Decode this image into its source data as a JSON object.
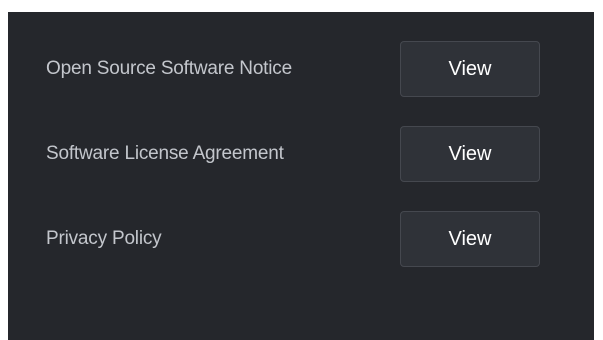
{
  "legal": {
    "items": [
      {
        "label": "Open Source Software Notice",
        "button_label": "View"
      },
      {
        "label": "Software License Agreement",
        "button_label": "View"
      },
      {
        "label": "Privacy Policy",
        "button_label": "View"
      }
    ]
  },
  "colors": {
    "panel_background": "#25272c",
    "button_background": "#2f3238",
    "button_border": "#45484f",
    "label_text": "#c3c6cc",
    "button_text": "#ffffff"
  }
}
